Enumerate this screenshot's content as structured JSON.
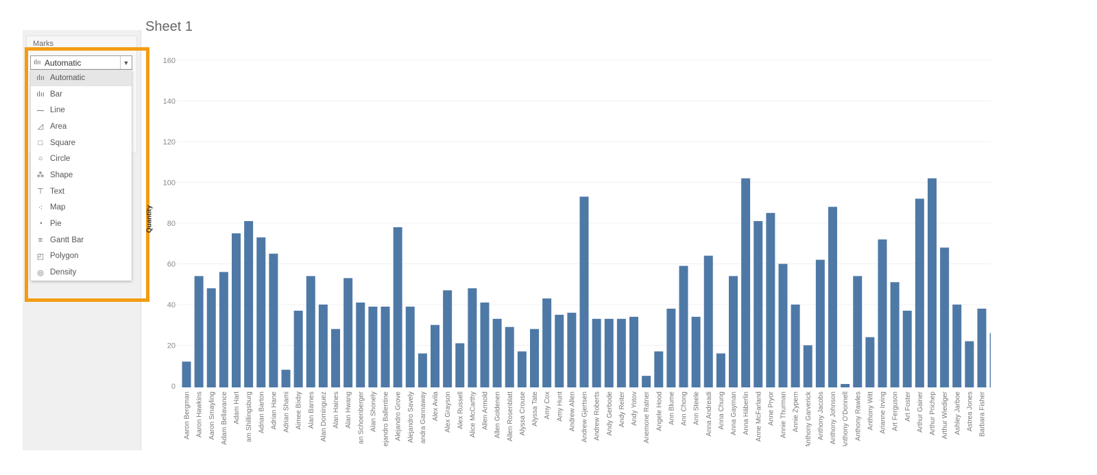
{
  "sheet_title": "Sheet 1",
  "marks": {
    "title": "Marks",
    "selected": "Automatic",
    "options": [
      {
        "label": "Automatic",
        "icon": "bar-chart-icon"
      },
      {
        "label": "Bar",
        "icon": "bar-chart-icon"
      },
      {
        "label": "Line",
        "icon": "line-icon"
      },
      {
        "label": "Area",
        "icon": "area-icon"
      },
      {
        "label": "Square",
        "icon": "square-icon"
      },
      {
        "label": "Circle",
        "icon": "circle-icon"
      },
      {
        "label": "Shape",
        "icon": "shape-icon"
      },
      {
        "label": "Text",
        "icon": "text-icon"
      },
      {
        "label": "Map",
        "icon": "map-icon"
      },
      {
        "label": "Pie",
        "icon": "pie-icon"
      },
      {
        "label": "Gantt Bar",
        "icon": "gantt-icon"
      },
      {
        "label": "Polygon",
        "icon": "polygon-icon"
      },
      {
        "label": "Density",
        "icon": "density-icon"
      }
    ]
  },
  "colors": {
    "bar": "#4e79a7",
    "highlight": "#f39c12"
  },
  "chart_data": {
    "type": "bar",
    "ylabel": "Quantity",
    "ylim": [
      0,
      160
    ],
    "yticks": [
      0,
      20,
      40,
      60,
      80,
      100,
      120,
      140,
      160
    ],
    "grid": true,
    "categories": [
      "Aaron Bergman",
      "Aaron Hawkins",
      "Aaron Smayling",
      "Adam Bellavance",
      "Adam Hart",
      "am Shillingsburg",
      "Adrian Barton",
      "Adrian Hane",
      "Adrian Shami",
      "Aimee Bixby",
      "Alan Barnes",
      "Alan Dominguez",
      "Alan Haines",
      "Alan Hwang",
      "an Schoenberger",
      "Alan Shonely",
      "ejandro Ballentine",
      "Alejandro Grove",
      "Alejandro Savely",
      "andra Gannaway",
      "Alex Avila",
      "Alex Grayson",
      "Alex Russell",
      "Alice McCarthy",
      "Allen Armold",
      "Allen Goldenen",
      "Allen Rosenblatt",
      "Alyssa Crouse",
      "Alyssa Tate",
      "Amy Cox",
      "Amy Hunt",
      "Andrew Allen",
      "Andrew Gjertsen",
      "Andrew Roberts",
      "Andy Gerbode",
      "Andy Reiter",
      "Andy Yotov",
      "Anemone Ratner",
      "Angele Hood",
      "Ann Blume",
      "Ann Chong",
      "Ann Steele",
      "Anna Andreadi",
      "Anna Chung",
      "Anna Gayman",
      "Anna Häberlin",
      "Anne McFarland",
      "Anne Pryor",
      "Annie Thurman",
      "Annie Zypern",
      "Anthony Garverick",
      "Anthony Jacobs",
      "Anthony Johnson",
      "Anthony O'Donnell",
      "Anthony Rawles",
      "Anthony Witt",
      "Arianne Irving",
      "Art Ferguson",
      "Art Foster",
      "Arthur Gainer",
      "Arthur Prichep",
      "Arthur Wiediger",
      "Ashley Jarboe",
      "Astrea Jones",
      "Barbara Fisher",
      ""
    ],
    "values": [
      12,
      54,
      48,
      56,
      75,
      81,
      73,
      65,
      8,
      37,
      54,
      40,
      28,
      53,
      41,
      39,
      39,
      78,
      39,
      16,
      30,
      47,
      21,
      48,
      41,
      33,
      29,
      17,
      28,
      43,
      35,
      36,
      93,
      33,
      33,
      33,
      34,
      5,
      17,
      38,
      59,
      34,
      64,
      16,
      54,
      102,
      81,
      85,
      60,
      40,
      20,
      62,
      88,
      1,
      54,
      24,
      72,
      51,
      37,
      92,
      102,
      68,
      40,
      22,
      38,
      26
    ]
  }
}
